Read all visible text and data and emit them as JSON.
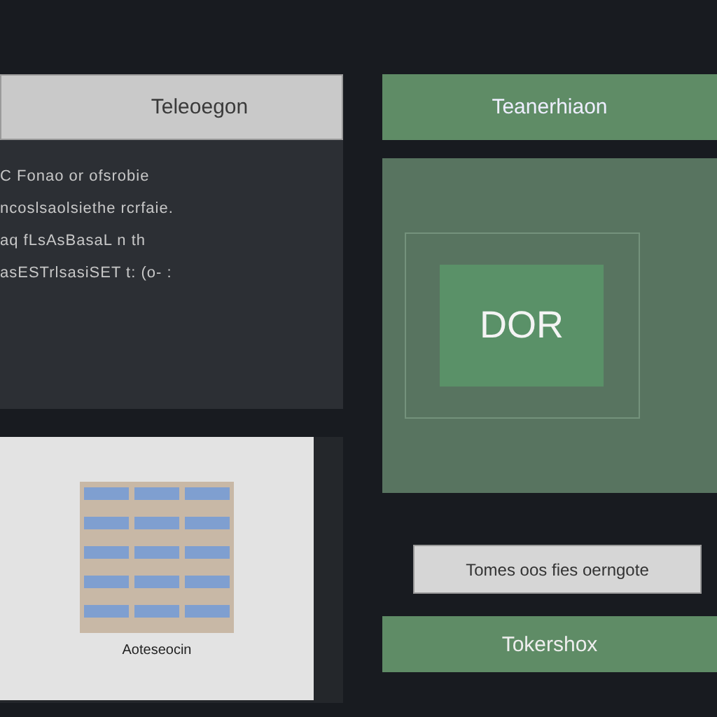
{
  "left_panel": {
    "title": "Teleoegon",
    "lines": [
      "C Fonao or ofsrobie",
      "ncoslsaolsiethe  rcrfaie.",
      "aq fLsAsBasaL n th",
      "asESTrlsasiSET t: (o- :"
    ]
  },
  "preview_card": {
    "caption": "Aoteseocin"
  },
  "right_panel": {
    "title": "Teanerhiaon",
    "badge": "DOR",
    "field": {
      "value": "Tomes oos fies oerngote"
    },
    "button": "Tokershox"
  }
}
